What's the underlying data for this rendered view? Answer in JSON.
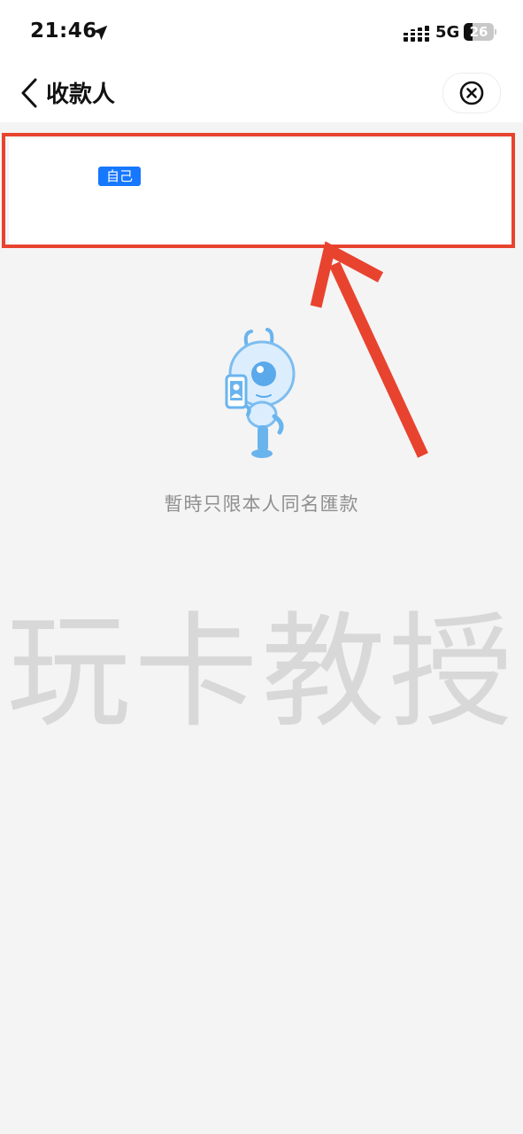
{
  "status_bar": {
    "time": "21:46",
    "network": "5G",
    "battery_level": "26",
    "icons": [
      "location-arrow-icon",
      "signal-icon",
      "battery-icon"
    ]
  },
  "nav": {
    "title": "收款人",
    "back_icon": "chevron-left-icon",
    "close_icon": "close-circle-icon"
  },
  "recipient_card": {
    "badge": "自己"
  },
  "empty_state": {
    "illustration": "ant-mascot-holding-phone",
    "message": "暫時只限本人同名匯款"
  },
  "watermark": "玩卡教授",
  "colors": {
    "accent": "#1677ff",
    "annotation": "#e8432f",
    "background": "#f4f4f4"
  }
}
